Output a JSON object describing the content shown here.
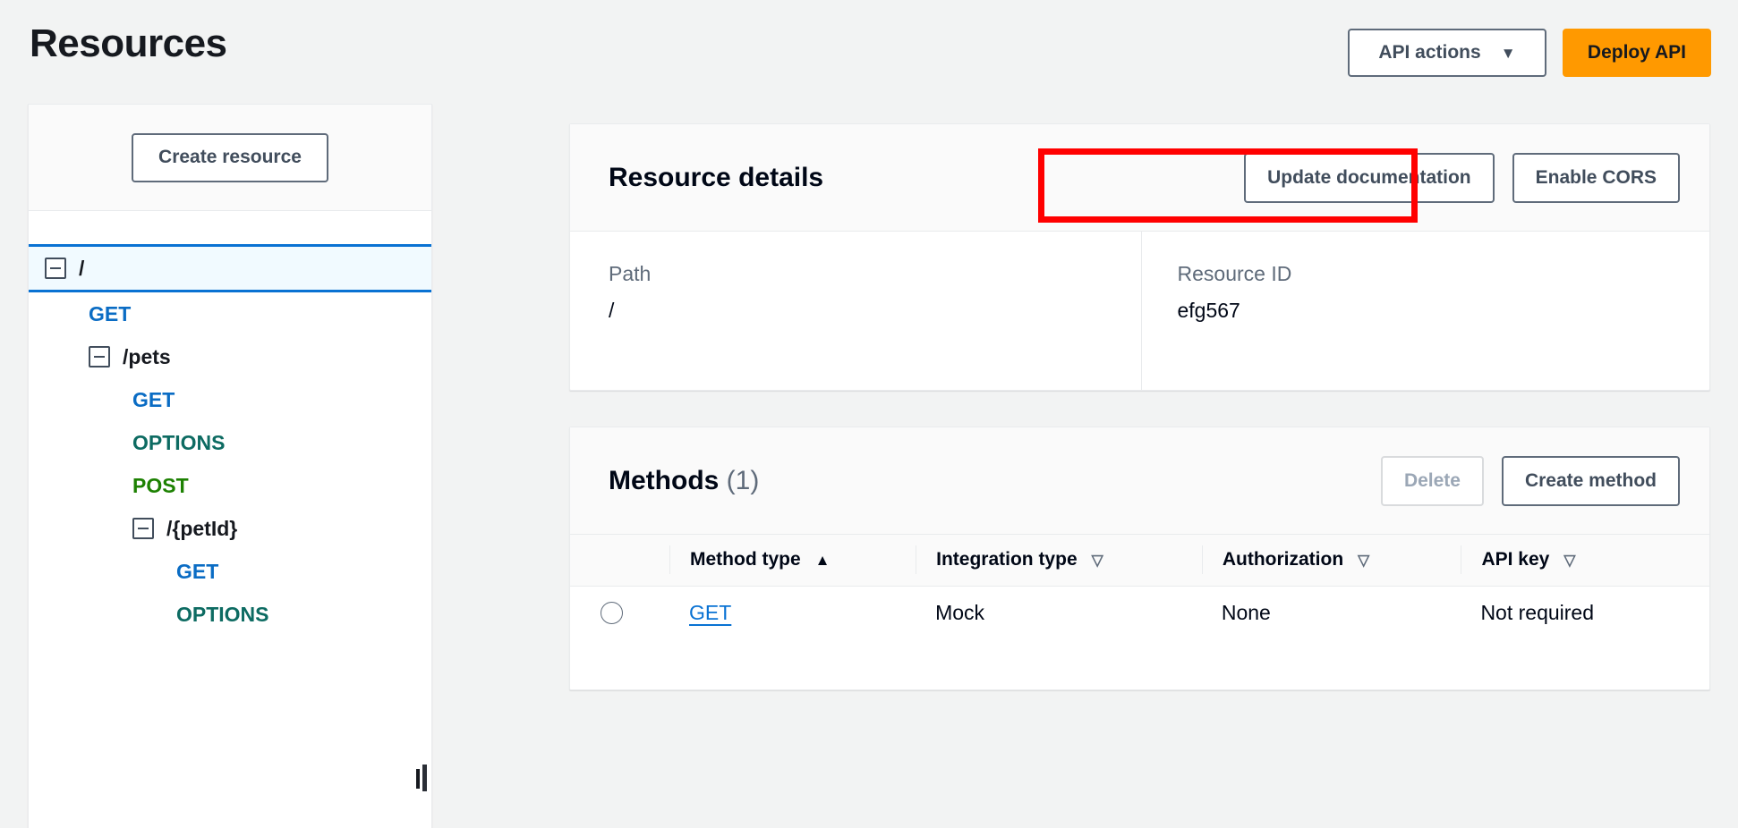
{
  "header": {
    "title": "Resources",
    "api_actions_label": "API actions",
    "api_actions_caret": "▼",
    "deploy_api_label": "Deploy API"
  },
  "sidebar": {
    "create_resource_label": "Create resource",
    "tree": [
      {
        "type": "resource",
        "label": "/",
        "depth": 0,
        "selected": true,
        "expandable": true
      },
      {
        "type": "method",
        "label": "GET",
        "depth": 1,
        "method": "get"
      },
      {
        "type": "resource",
        "label": "/pets",
        "depth": 1,
        "selected": false,
        "expandable": true
      },
      {
        "type": "method",
        "label": "GET",
        "depth": 2,
        "method": "get"
      },
      {
        "type": "method",
        "label": "OPTIONS",
        "depth": 2,
        "method": "options"
      },
      {
        "type": "method",
        "label": "POST",
        "depth": 2,
        "method": "post"
      },
      {
        "type": "resource",
        "label": "/{petId}",
        "depth": 2,
        "selected": false,
        "expandable": true
      },
      {
        "type": "method",
        "label": "GET",
        "depth": 3,
        "method": "get"
      },
      {
        "type": "method",
        "label": "OPTIONS",
        "depth": 3,
        "method": "options"
      }
    ]
  },
  "resource_details": {
    "title": "Resource details",
    "update_documentation_label": "Update documentation",
    "enable_cors_label": "Enable CORS",
    "path_label": "Path",
    "path_value": "/",
    "resource_id_label": "Resource ID",
    "resource_id_value": "efg567"
  },
  "methods": {
    "title": "Methods",
    "count": "(1)",
    "delete_label": "Delete",
    "create_method_label": "Create method",
    "columns": [
      {
        "label": "Method type",
        "sort": "asc"
      },
      {
        "label": "Integration type",
        "sort": "none"
      },
      {
        "label": "Authorization",
        "sort": "none"
      },
      {
        "label": "API key",
        "sort": "none"
      }
    ],
    "sort_asc_glyph": "▲",
    "sort_none_glyph": "▽",
    "rows": [
      {
        "method_type": "GET",
        "integration_type": "Mock",
        "authorization": "None",
        "api_key": "Not required"
      }
    ]
  },
  "annotation": {
    "color": "#ff0000",
    "target": "Update documentation"
  },
  "colors": {
    "accent_orange": "#ff9900",
    "link_blue": "#0972d3",
    "method_get": "#0a6cc4",
    "method_options": "#0d6b62",
    "method_post": "#1d8102",
    "selected_row_bg": "#f1faff",
    "page_bg": "#f2f3f3"
  }
}
